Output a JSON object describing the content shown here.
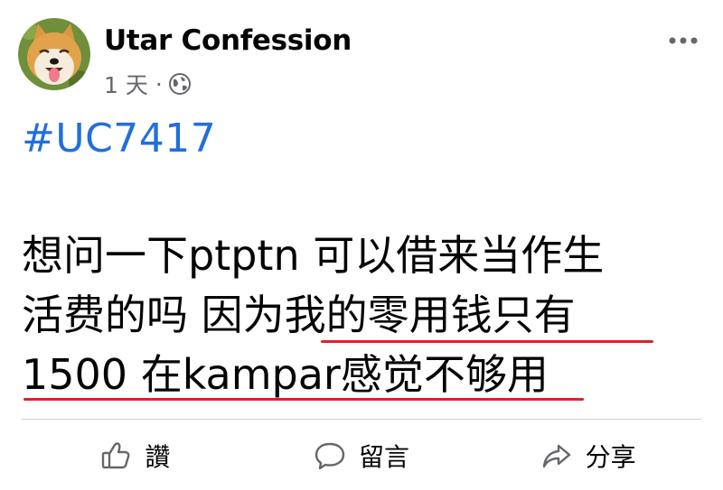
{
  "post": {
    "page_name": "Utar Confession",
    "timestamp": "1 天",
    "separator": "·",
    "audience_icon": "globe-icon",
    "more_icon": "more-options-icon",
    "hashtag": "#UC7417",
    "body_lines": [
      "想问一下ptptn 可以借来当作生",
      "活费的吗 因为我的零用钱只有",
      "1500 在kampar感觉不够用"
    ],
    "highlight_color": "#e0202a",
    "link_color": "#216fdb"
  },
  "actions": {
    "like_label": "讚",
    "like_icon": "thumbs-up-icon",
    "comment_label": "留言",
    "comment_icon": "speech-bubble-icon",
    "share_label": "分享",
    "share_icon": "share-arrow-icon"
  }
}
